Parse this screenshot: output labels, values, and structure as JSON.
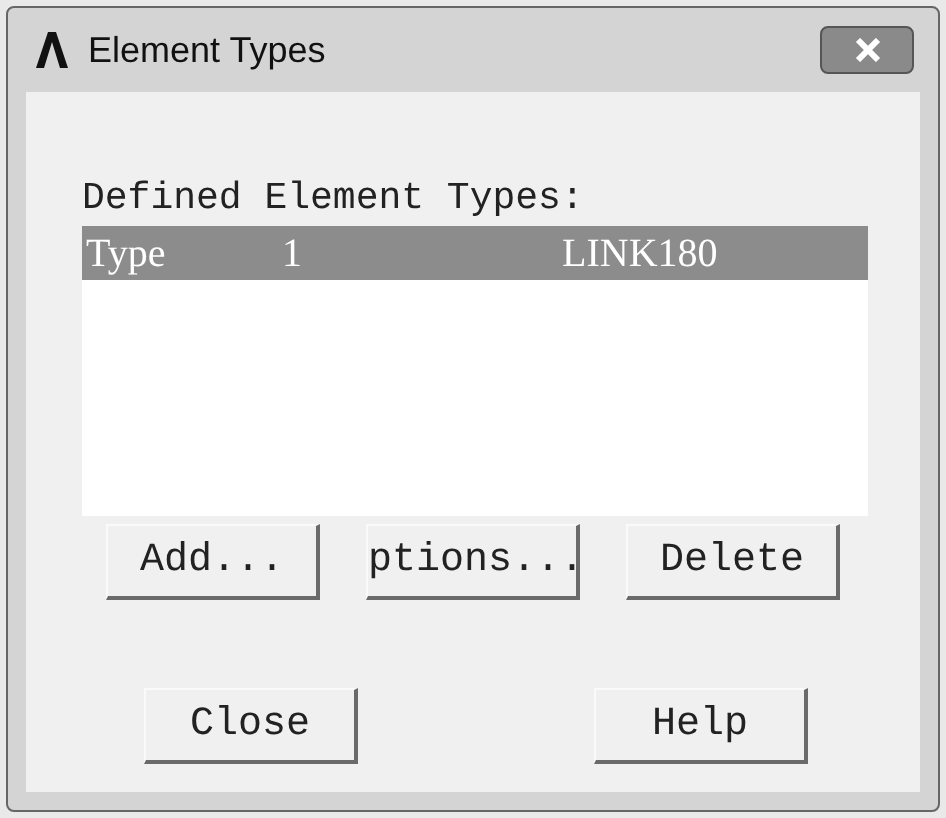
{
  "window": {
    "title": "Element Types"
  },
  "list": {
    "label": "Defined Element Types:",
    "rows": [
      {
        "cells": [
          "Type",
          "1",
          "LINK180"
        ],
        "selected": true
      }
    ]
  },
  "action_buttons": [
    "Add...",
    "ptions...",
    "Delete"
  ],
  "footer_buttons": [
    "Close",
    "Help"
  ]
}
